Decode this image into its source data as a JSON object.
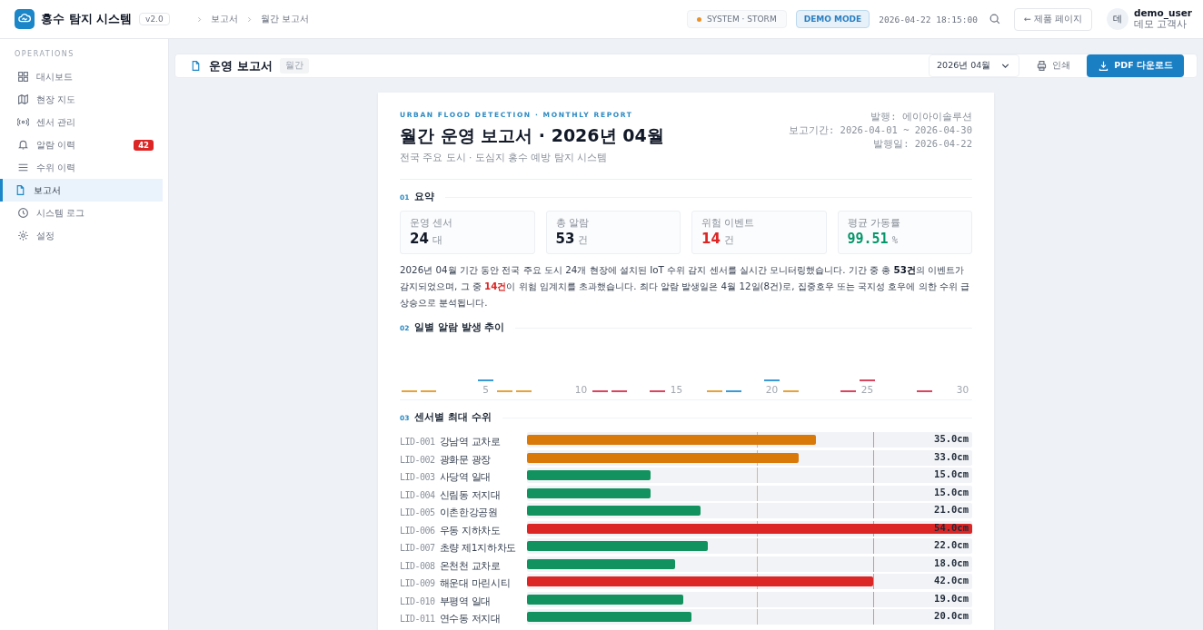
{
  "header": {
    "app_title": "홍수 탐지 시스템",
    "version": "v2.0",
    "breadcrumb": [
      "보고서",
      "월간 보고서"
    ],
    "status": "SYSTEM · STORM",
    "mode_badge": "DEMO MODE",
    "datetime": "2026-04-22 18:15:00",
    "back_link": "← 제품 페이지",
    "user": {
      "avatar": "데",
      "name": "demo_user",
      "org": "데모 고객사"
    }
  },
  "sidebar": {
    "section": "OPERATIONS",
    "items": [
      {
        "label": "대시보드",
        "selected": false
      },
      {
        "label": "현장 지도",
        "selected": false
      },
      {
        "label": "센서 관리",
        "selected": false
      },
      {
        "label": "알람 이력",
        "selected": false,
        "badge": "42"
      },
      {
        "label": "수위 이력",
        "selected": false
      },
      {
        "label": "보고서",
        "selected": true
      },
      {
        "label": "시스템 로그",
        "selected": false
      },
      {
        "label": "설정",
        "selected": false
      }
    ]
  },
  "toolbar": {
    "title": "운영 보고서",
    "tag": "월간",
    "month_select": "2026년 04월",
    "print_button": "인쇄",
    "pdf_button": "PDF 다운로드"
  },
  "report": {
    "eyebrow": "URBAN FLOOD DETECTION · MONTHLY REPORT",
    "title": "월간 운영 보고서 · 2026년 04월",
    "subtitle": "전국 주요 도시 · 도심지 홍수 예방 탐지 시스템",
    "meta": [
      "발행: 에이아이솔루션",
      "보고기간: 2026-04-01 ~ 2026-04-30",
      "발행일: 2026-04-22"
    ],
    "summary": {
      "number": "01",
      "title": "요약",
      "kpis": [
        {
          "label": "운영 센서",
          "value": "24",
          "unit": "대",
          "kind": "neutral"
        },
        {
          "label": "총 알람",
          "value": "53",
          "unit": "건",
          "kind": "neutral"
        },
        {
          "label": "위험 이벤트",
          "value": "14",
          "unit": "건",
          "kind": "danger"
        },
        {
          "label": "평균 가동률",
          "value": "99.51",
          "unit": "%",
          "kind": "success"
        }
      ],
      "paragraph": "2026년 04월 기간 동안 전국 주요 도시 24개 현장에 설치된 IoT 수위 감지 센서를 실시간 모니터링했습니다. 기간 중 총 **53건**의 이벤트가 감지되었으며, 그 중 **14건**이 위험 임계치를 초과했습니다. 최다 알람 발생일은 4월 12일(8건)로, 집중호우 또는 국지성 호우에 의한 수위 급상승으로 분석됩니다."
    },
    "trend": {
      "number": "02",
      "title": "일별 알람 발생 추이",
      "day_labels": [
        "5",
        "10",
        "15",
        "20",
        "25",
        "30"
      ]
    },
    "sensors": {
      "number": "03",
      "title": "센서별 최대 수위",
      "thresholds": [
        {
          "kind": "warning",
          "level": 0.517
        },
        {
          "kind": "danger",
          "level": 0.778
        }
      ],
      "rows": [
        {
          "id": "LID-001",
          "name": "강남역 교차로",
          "reading": "35.0cm",
          "kind": "warning",
          "level": 0.648
        },
        {
          "id": "LID-002",
          "name": "광화문 광장",
          "reading": "33.0cm",
          "kind": "warning",
          "level": 0.611
        },
        {
          "id": "LID-003",
          "name": "사당역 일대",
          "reading": "15.0cm",
          "kind": "normal",
          "level": 0.278
        },
        {
          "id": "LID-004",
          "name": "신림동 저지대",
          "reading": "15.0cm",
          "kind": "normal",
          "level": 0.278
        },
        {
          "id": "LID-005",
          "name": "이촌한강공원",
          "reading": "21.0cm",
          "kind": "normal",
          "level": 0.389
        },
        {
          "id": "LID-006",
          "name": "우동 지하차도",
          "reading": "54.0cm",
          "kind": "danger",
          "level": 1.0
        },
        {
          "id": "LID-007",
          "name": "초량 제1지하차도",
          "reading": "22.0cm",
          "kind": "normal",
          "level": 0.407
        },
        {
          "id": "LID-008",
          "name": "온천천 교차로",
          "reading": "18.0cm",
          "kind": "normal",
          "level": 0.333
        },
        {
          "id": "LID-009",
          "name": "해운대 마린시티",
          "reading": "42.0cm",
          "kind": "danger",
          "level": 0.778
        },
        {
          "id": "LID-010",
          "name": "부평역 일대",
          "reading": "19.0cm",
          "kind": "normal",
          "level": 0.352
        },
        {
          "id": "LID-011",
          "name": "연수동 저지대",
          "reading": "20.0cm",
          "kind": "normal",
          "level": 0.37
        }
      ]
    }
  }
}
